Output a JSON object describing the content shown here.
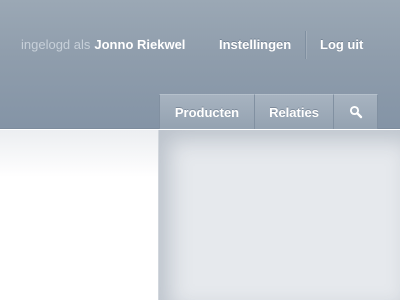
{
  "header": {
    "login_prefix": "ingelogd als",
    "user_name": "Jonno Riekwel",
    "settings_label": "Instellingen",
    "logout_label": "Log uit"
  },
  "nav": {
    "tabs": [
      {
        "label": "Producten"
      },
      {
        "label": "Relaties"
      }
    ],
    "search_icon": "search-icon"
  },
  "colors": {
    "header_top": "#9ba8b5",
    "header_bottom": "#8494a6",
    "tab_fill": "#a0adbb",
    "content_bg": "#e6e9ed",
    "text_light": "#ffffff",
    "text_muted": "#c7d0d9"
  }
}
